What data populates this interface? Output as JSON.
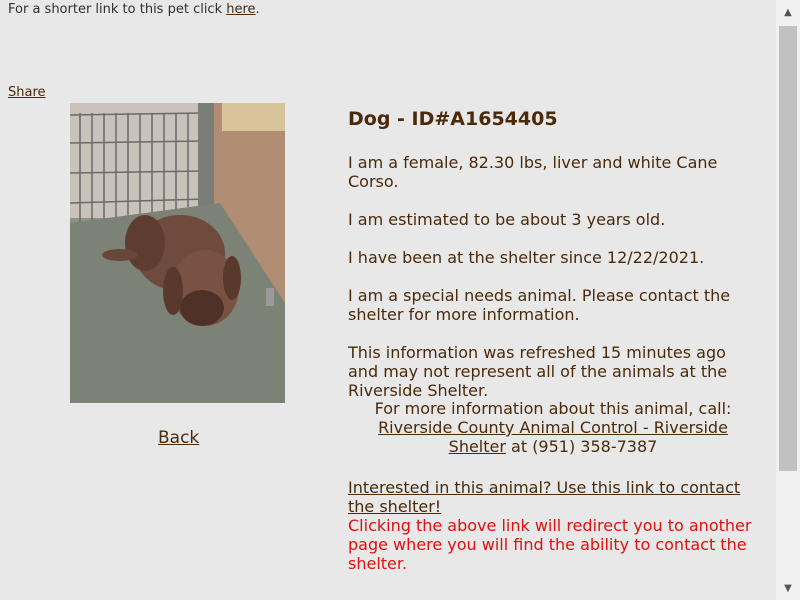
{
  "top": {
    "prefix": "For a shorter link to this pet click ",
    "link": "here",
    "suffix": "."
  },
  "share_label": "Share",
  "photo": {
    "icon": "dog-photo"
  },
  "back_label": "Back",
  "info": {
    "title": "Dog - ID#A1654405",
    "description": "I am a female, 82.30 lbs, liver and white Cane Corso.",
    "age": "I am estimated to be about 3 years old.",
    "since": "I have been at the shelter since 12/22/2021.",
    "special_needs": "I am a special needs animal. Please contact the shelter for more information.",
    "refresh_note": "This information was refreshed 15 minutes ago and may not represent all of the animals at the Riverside Shelter.",
    "contact_intro": "For more information about this animal, call:",
    "shelter_link": "Riverside County Animal Control - Riverside Shelter",
    "phone_text": " at (951) 358-7387",
    "interest_link": "Interested in this animal? Use this link to contact the shelter!",
    "redirect_note": "Clicking the above link will redirect you to another page where you will find the ability to contact the shelter."
  },
  "colors": {
    "text": "#4a2a0a",
    "warning": "#e01010",
    "background": "#e8e8e8"
  }
}
